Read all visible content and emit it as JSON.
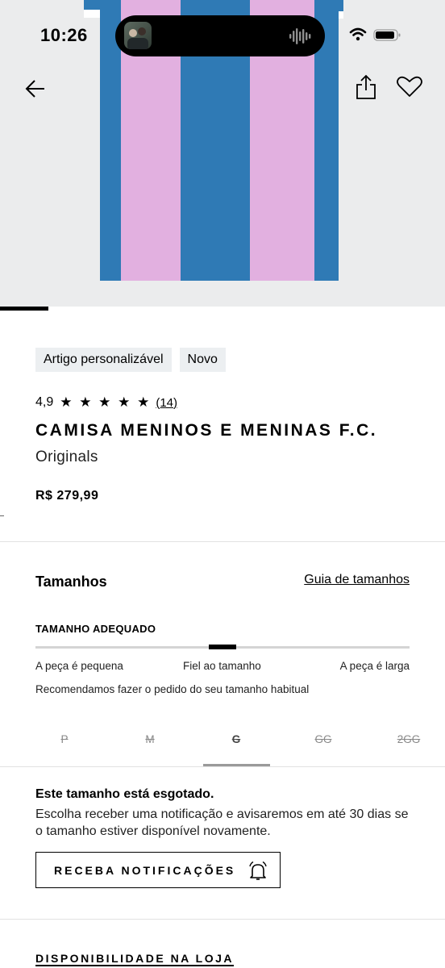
{
  "status_bar": {
    "time": "10:26"
  },
  "hero": {
    "image_alt": "Camisa listrada azul e rosa",
    "colors": {
      "blue": "#2f7ab5",
      "pink": "#e2b0e0",
      "background": "#ebeced"
    }
  },
  "badges": [
    "Artigo personalizável",
    "Novo"
  ],
  "rating": {
    "score": "4,9",
    "stars": "★ ★ ★ ★ ★",
    "count": "(14)"
  },
  "product": {
    "title": "CAMISA MENINOS E MENINAS F.C.",
    "subtitle": "Originals",
    "price": "R$ 279,99"
  },
  "sizes": {
    "title": "Tamanhos",
    "guide_link": "Guia de tamanhos",
    "fit_title": "TAMANHO ADEQUADO",
    "fit_position": 0.5,
    "fit_labels": [
      "A peça é pequena",
      "Fiel ao tamanho",
      "A peça é larga"
    ],
    "fit_note": "Recomendamos fazer o pedido do seu tamanho habitual",
    "options": [
      "P",
      "M",
      "G",
      "GG",
      "2GG"
    ],
    "selected": "G"
  },
  "out_of_stock": {
    "title": "Este tamanho está esgotado.",
    "text": "Escolha receber uma notificação e avisaremos em até 30 dias se o tamanho estiver disponível novamente.",
    "button_label": "RECEBA NOTIFICAÇÕES"
  },
  "store": {
    "title": "DISPONIBILIDADE NA LOJA"
  }
}
